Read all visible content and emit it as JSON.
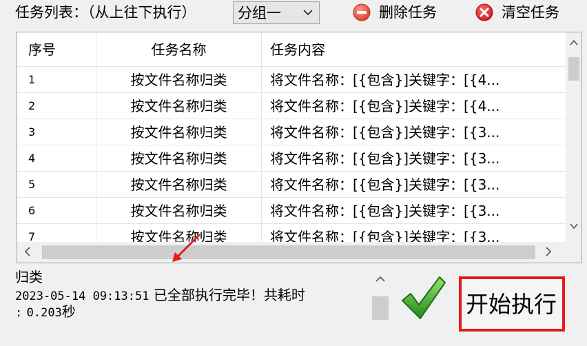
{
  "toolbar": {
    "task_list_label": "任务列表：（从上往下执行）",
    "group_selected": "分组一",
    "delete_task_label": "删除任务",
    "clear_tasks_label": "清空任务"
  },
  "table": {
    "headers": [
      "序号",
      "任务名称",
      "任务内容"
    ],
    "rows": [
      {
        "index": "1",
        "name": "按文件名称归类",
        "content": "将文件名称：[{包含}]关键字：[{4..."
      },
      {
        "index": "2",
        "name": "按文件名称归类",
        "content": "将文件名称：[{包含}]关键字：[{4..."
      },
      {
        "index": "3",
        "name": "按文件名称归类",
        "content": "将文件名称：[{包含}]关键字：[{3..."
      },
      {
        "index": "4",
        "name": "按文件名称归类",
        "content": "将文件名称：[{包含}]关键字：[{3..."
      },
      {
        "index": "5",
        "name": "按文件名称归类",
        "content": "将文件名称：[{包含}]关键字：[{3..."
      },
      {
        "index": "6",
        "name": "按文件名称归类",
        "content": "将文件名称：[{包含}]关键字：[{3..."
      },
      {
        "index": "7",
        "name": "按文件名称归类",
        "content": "将文件名称：[{包含}]关键字：[{3..."
      }
    ]
  },
  "log": {
    "line1": "归类",
    "line2_time": "2023-05-14 09:13:51",
    "line2_text": "已全部执行完毕！共耗时",
    "line3_prefix": ":",
    "line3_value": "0.203",
    "line3_unit": "秒"
  },
  "start_button": {
    "label": "开始执行"
  },
  "colors": {
    "delete_icon": "#e6483a",
    "clear_icon": "#e0242a",
    "annotation": "#e01d1d",
    "check": "#2e9a2a"
  },
  "icons": {
    "delete": "minus-circle-icon",
    "clear": "x-circle-icon",
    "check": "check-icon"
  }
}
